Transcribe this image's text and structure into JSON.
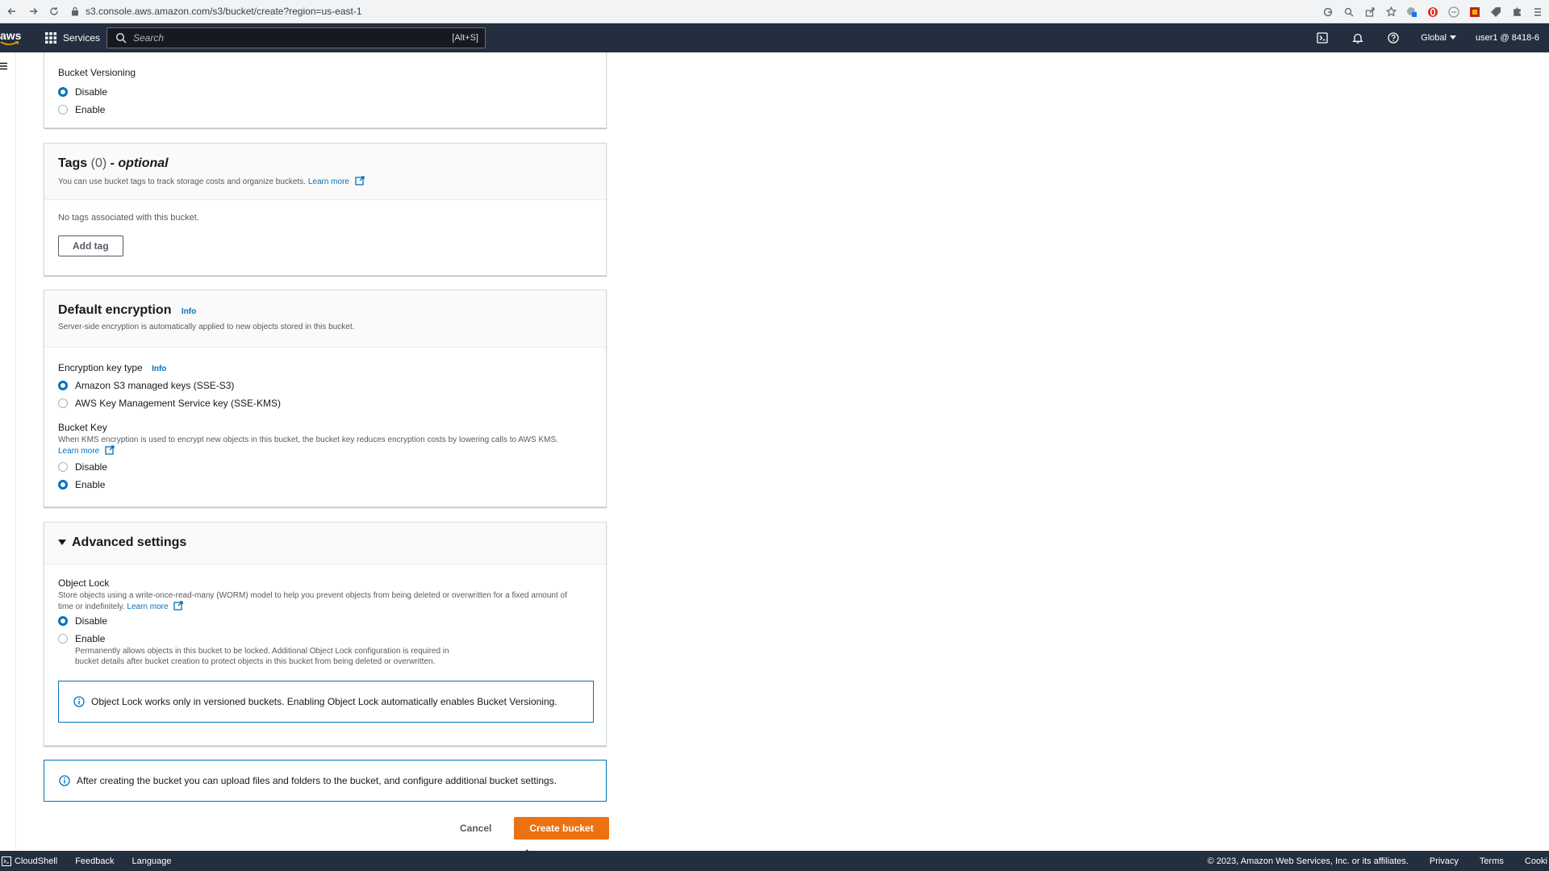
{
  "browser": {
    "url": "s3.console.aws.amazon.com/s3/bucket/create?region=us-east-1"
  },
  "topnav": {
    "logo": "aws",
    "services": "Services",
    "search_placeholder": "Search",
    "search_shortcut": "[Alt+S]",
    "region": "Global",
    "account": "user1 @ 8418-6"
  },
  "versioning": {
    "label": "Bucket Versioning",
    "options": [
      "Disable",
      "Enable"
    ],
    "selected": "Disable"
  },
  "tags": {
    "title": "Tags",
    "count": "(0)",
    "optional": "- optional",
    "description": "You can use bucket tags to track storage costs and organize buckets.",
    "learn_more": "Learn more",
    "empty": "No tags associated with this bucket.",
    "add_button": "Add tag"
  },
  "encryption": {
    "title": "Default encryption",
    "info": "Info",
    "description": "Server-side encryption is automatically applied to new objects stored in this bucket.",
    "key_type_label": "Encryption key type",
    "key_type_info": "Info",
    "key_options": [
      "Amazon S3 managed keys (SSE-S3)",
      "AWS Key Management Service key (SSE-KMS)"
    ],
    "key_selected": "Amazon S3 managed keys (SSE-S3)",
    "bucket_key_label": "Bucket Key",
    "bucket_key_desc": "When KMS encryption is used to encrypt new objects in this bucket, the bucket key reduces encryption costs by lowering calls to AWS KMS.",
    "bucket_key_learn_more": "Learn more",
    "bucket_key_options": [
      "Disable",
      "Enable"
    ],
    "bucket_key_selected": "Enable"
  },
  "advanced": {
    "title": "Advanced settings",
    "object_lock_label": "Object Lock",
    "object_lock_desc": "Store objects using a write-once-read-many (WORM) model to help you prevent objects from being deleted or overwritten for a fixed amount of time or indefinitely.",
    "learn_more": "Learn more",
    "options": [
      "Disable",
      "Enable"
    ],
    "selected": "Disable",
    "enable_desc": "Permanently allows objects in this bucket to be locked. Additional Object Lock configuration is required in bucket details after bucket creation to protect objects in this bucket from being deleted or overwritten.",
    "alert": "Object Lock works only in versioned buckets. Enabling Object Lock automatically enables Bucket Versioning."
  },
  "after_info": "After creating the bucket you can upload files and folders to the bucket, and configure additional bucket settings.",
  "actions": {
    "cancel": "Cancel",
    "create": "Create bucket"
  },
  "footer": {
    "cloudshell": "CloudShell",
    "feedback": "Feedback",
    "language": "Language",
    "copyright": "© 2023, Amazon Web Services, Inc. or its affiliates.",
    "privacy": "Privacy",
    "terms": "Terms",
    "cookie": "Cooki"
  },
  "colors": {
    "nav_bg": "#232f3e",
    "primary": "#ec7211",
    "link": "#0073bb"
  }
}
